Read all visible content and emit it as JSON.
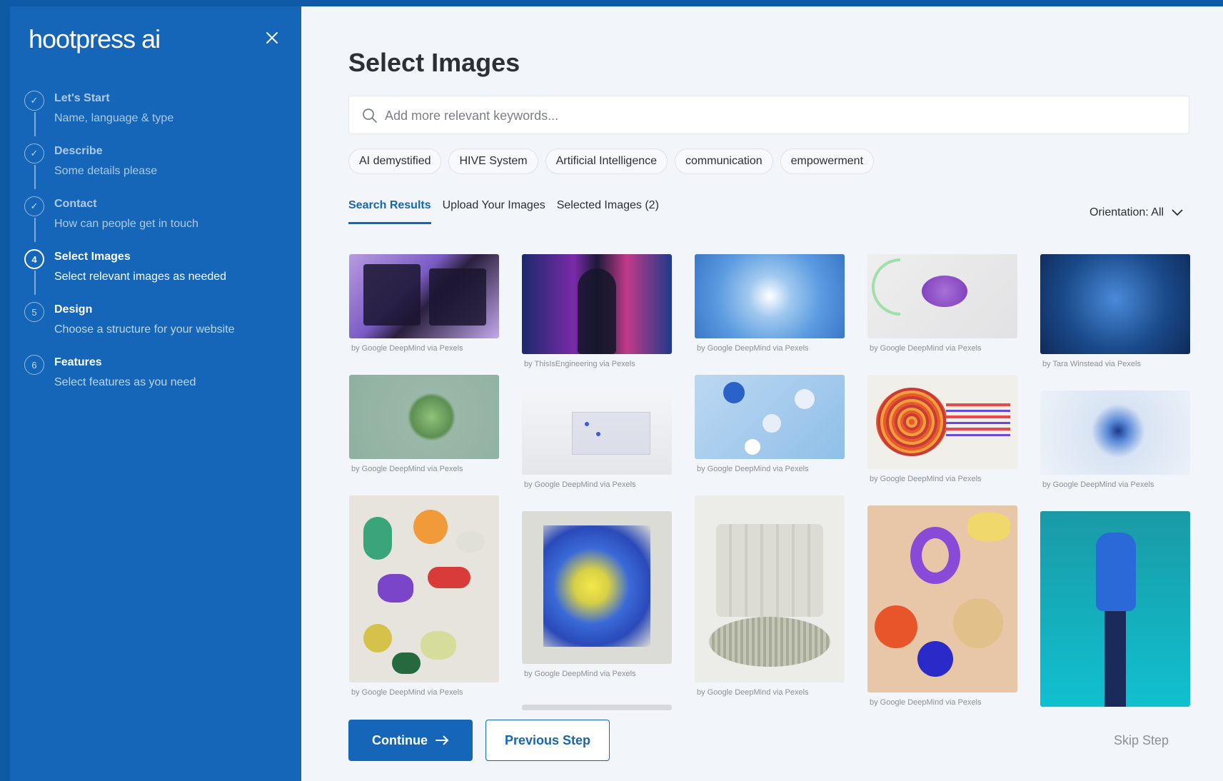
{
  "sidebar": {
    "logo": "hootpress ai",
    "steps": [
      {
        "marker": "✓",
        "title": "Let's Start",
        "subtitle": "Name, language & type"
      },
      {
        "marker": "✓",
        "title": "Describe",
        "subtitle": "Some details please"
      },
      {
        "marker": "✓",
        "title": "Contact",
        "subtitle": "How can people get in touch"
      },
      {
        "marker": "4",
        "title": "Select Images",
        "subtitle": "Select relevant images as needed"
      },
      {
        "marker": "5",
        "title": "Design",
        "subtitle": "Choose a structure for your website"
      },
      {
        "marker": "6",
        "title": "Features",
        "subtitle": "Select features as you need"
      }
    ]
  },
  "main": {
    "title": "Select Images",
    "search_placeholder": "Add more relevant keywords...",
    "chips": [
      "AI demystified",
      "HIVE System",
      "Artificial Intelligence",
      "communication",
      "empowerment"
    ],
    "tabs": [
      "Search Results",
      "Upload Your Images",
      "Selected Images (2)"
    ],
    "orientation": "Orientation: All",
    "images": [
      {
        "credit": "by Google DeepMind via Pexels"
      },
      {
        "credit": "by ThisIsEngineering via Pexels"
      },
      {
        "credit": "by Google DeepMind via Pexels"
      },
      {
        "credit": "by Google DeepMind via Pexels"
      },
      {
        "credit": "by Tara Winstead via Pexels"
      },
      {
        "credit": "by Google DeepMind via Pexels"
      },
      {
        "credit": "by Google DeepMind via Pexels"
      },
      {
        "credit": "by Google DeepMind via Pexels"
      },
      {
        "credit": "by Google DeepMind via Pexels"
      },
      {
        "credit": "by Google DeepMind via Pexels"
      },
      {
        "credit": "by Google DeepMind via Pexels"
      },
      {
        "credit": "by Google DeepMind via Pexels"
      },
      {
        "credit": "by Google DeepMind via Pexels"
      },
      {
        "credit": "by Google DeepMind via Pexels"
      },
      {
        "credit": ""
      }
    ],
    "buttons": {
      "continue": "Continue",
      "previous": "Previous Step",
      "skip": "Skip Step"
    }
  },
  "colors": {
    "accent": "#1565b8",
    "background": "#f2f5fa"
  }
}
